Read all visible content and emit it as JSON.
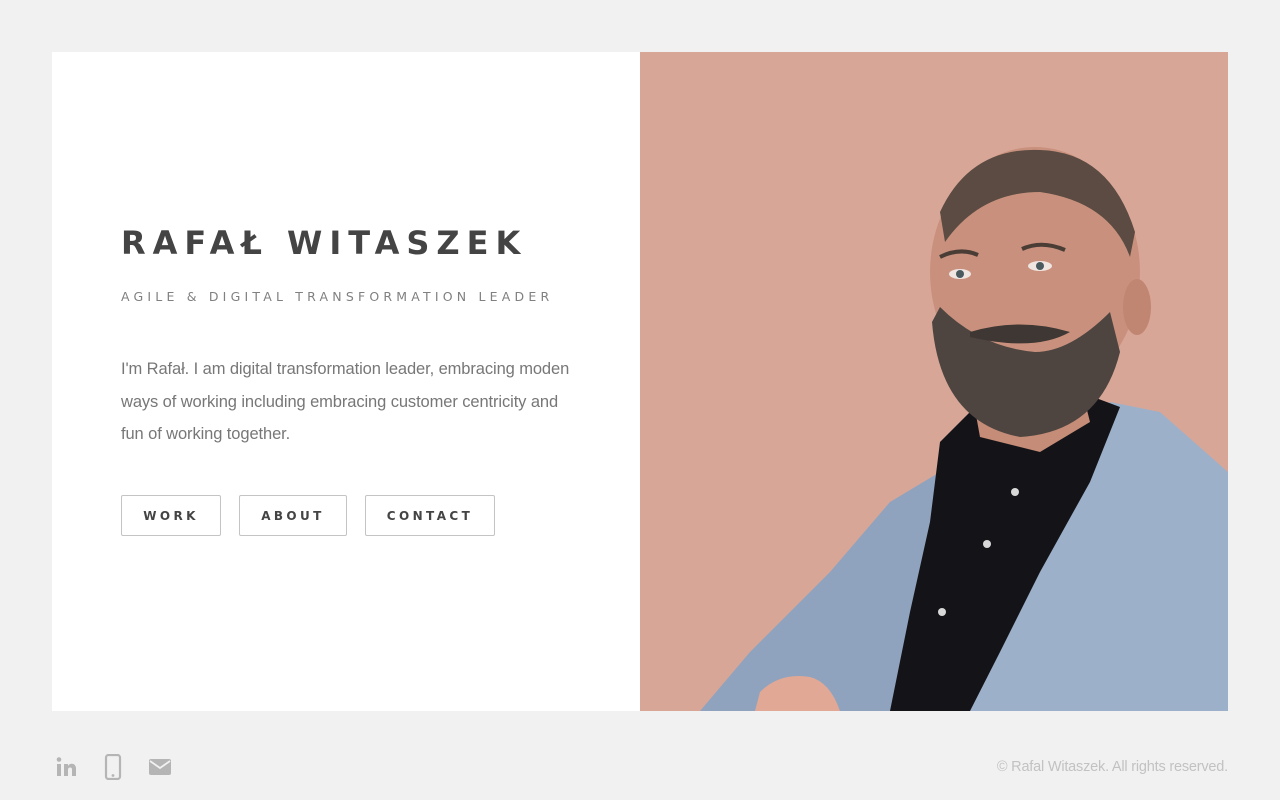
{
  "profile": {
    "name": "RAFAŁ WITASZEK",
    "subtitle": "AGILE & DIGITAL TRANSFORMATION LEADER",
    "bio": "I'm Rafał. I am digital transformation leader, embracing moden ways of working including embracing customer centricity and fun of working together.",
    "photo_alt": "Portrait of Rafał Witaszek"
  },
  "nav": {
    "work_label": "WORK",
    "about_label": "ABOUT",
    "contact_label": "CONTACT"
  },
  "footer": {
    "icons": [
      "linkedin-icon",
      "phone-icon",
      "email-icon"
    ],
    "copyright": "© Rafal Witaszek. All rights reserved."
  },
  "colors": {
    "page_background": "#f1f1f1",
    "card_background": "#ffffff",
    "heading": "#444444",
    "text_muted": "#777777",
    "footer_icon": "#b5b5b5",
    "photo_background": "#d4a08f"
  }
}
